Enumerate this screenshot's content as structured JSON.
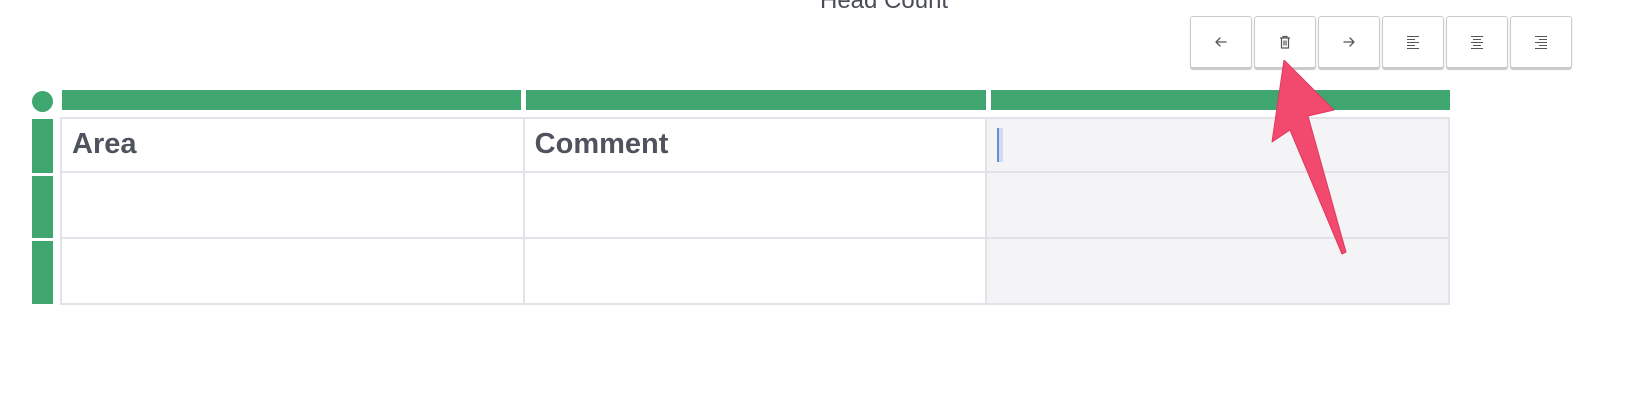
{
  "page": {
    "heading": "Head Count"
  },
  "toolbar": {
    "buttons": [
      {
        "name": "move-column-left",
        "icon": "arrow-left-icon"
      },
      {
        "name": "delete-column",
        "icon": "trash-icon"
      },
      {
        "name": "move-column-right",
        "icon": "arrow-right-icon"
      },
      {
        "name": "align-left",
        "icon": "align-left-icon"
      },
      {
        "name": "align-center",
        "icon": "align-center-icon"
      },
      {
        "name": "align-right",
        "icon": "align-right-icon"
      }
    ]
  },
  "table": {
    "header": [
      "Area",
      "Comment",
      ""
    ],
    "rows": [
      [
        "",
        "",
        ""
      ],
      [
        "",
        "",
        ""
      ]
    ],
    "selected_column": 3
  },
  "colors": {
    "accent_green": "#3fa66f",
    "annotation_arrow": "#f24a6f",
    "selected_cell_bg": "#f4f4f7"
  }
}
